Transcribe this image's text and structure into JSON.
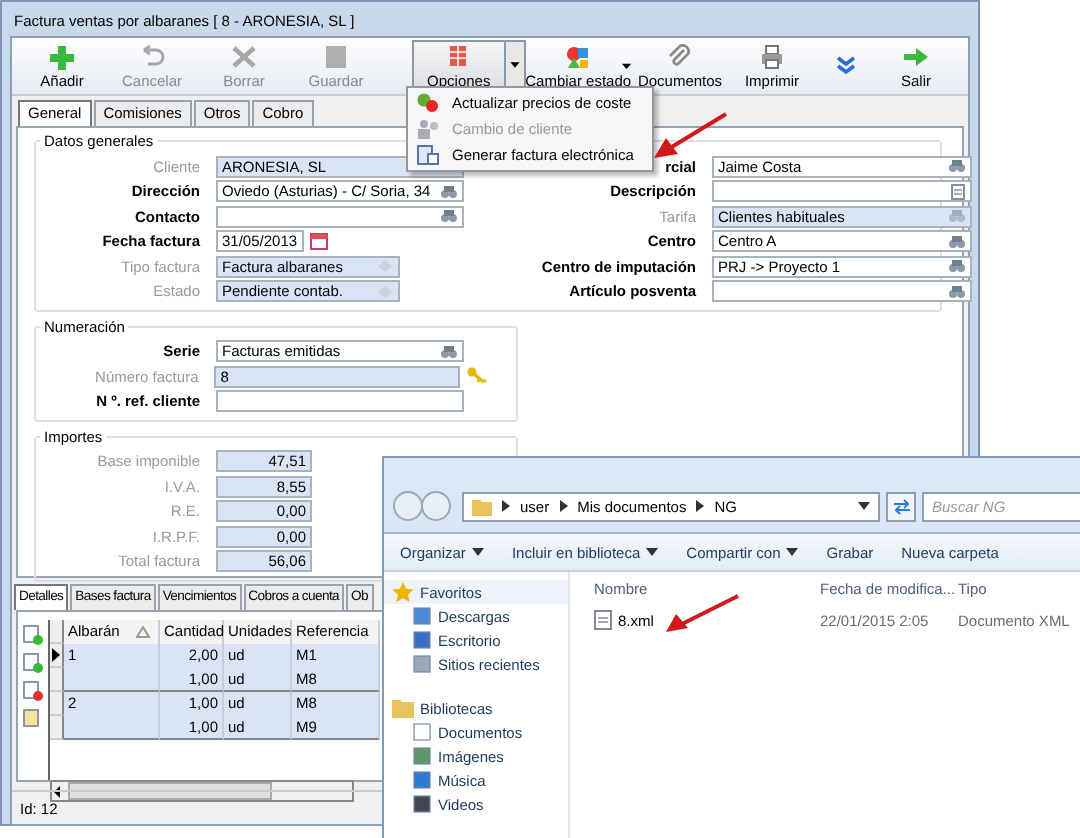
{
  "window": {
    "title": "Factura ventas por albaranes  [ 8  -  ARONESIA, SL ]"
  },
  "toolbar": [
    {
      "label": "Añadir",
      "disabled": false,
      "selected": false
    },
    {
      "label": "Cancelar",
      "disabled": true,
      "selected": false
    },
    {
      "label": "Borrar",
      "disabled": true,
      "selected": false
    },
    {
      "label": "Guardar",
      "disabled": true,
      "selected": false
    },
    {
      "label": "Opciones",
      "disabled": false,
      "selected": true
    },
    {
      "label": "Cambiar estado",
      "disabled": false,
      "selected": false
    },
    {
      "label": "Documentos",
      "disabled": false,
      "selected": false
    },
    {
      "label": "Imprimir",
      "disabled": false,
      "selected": false
    },
    {
      "label": "Salir",
      "disabled": false,
      "selected": false
    }
  ],
  "options_menu": [
    {
      "label": "Actualizar precios de coste",
      "disabled": false
    },
    {
      "label": "Cambio de cliente",
      "disabled": true
    },
    {
      "label": "Generar factura electrónica",
      "disabled": false
    }
  ],
  "tabs": [
    {
      "label": "General",
      "selected": true
    },
    {
      "label": "Comisiones",
      "selected": false
    },
    {
      "label": "Otros",
      "selected": false
    },
    {
      "label": "Cobro",
      "selected": false
    }
  ],
  "groups": [
    {
      "title": "Datos generales",
      "columns": [
        [
          {
            "label": "Cliente",
            "value": "ARONESIA, SL",
            "readonly": true,
            "kind": "text"
          },
          {
            "label": "Dirección",
            "value": "Oviedo (Asturias)  -  C/ Soria, 34",
            "readonly": false,
            "kind": "lookup"
          },
          {
            "label": "Contacto",
            "readonly": false,
            "kind": "lookup"
          },
          {
            "label": "Fecha factura",
            "value": "31/05/2013",
            "readonly": false,
            "kind": "date"
          },
          {
            "label": "Tipo factura",
            "value": "Factura albaranes",
            "readonly": true,
            "kind": "combo"
          },
          {
            "label": "Estado",
            "value": "Pendiente contab.",
            "readonly": true,
            "kind": "combo"
          }
        ],
        [
          {
            "label": "rcial",
            "value": "Jaime Costa",
            "readonly": false,
            "kind": "lookup"
          },
          {
            "label": "Descripción",
            "readonly": false,
            "kind": "memo"
          },
          {
            "label": "Tarifa",
            "value": "Clientes habituales",
            "readonly": true,
            "kind": "lookup"
          },
          {
            "label": "Centro",
            "value": "Centro A",
            "readonly": false,
            "kind": "lookup"
          },
          {
            "label": "Centro de imputación",
            "value": "PRJ -> Proyecto 1",
            "readonly": false,
            "kind": "lookup"
          },
          {
            "label": "Artículo posventa",
            "readonly": false,
            "kind": "lookup"
          }
        ]
      ]
    },
    {
      "title": "Numeración",
      "columns": [
        [
          {
            "label": "Serie",
            "value": "Facturas emitidas",
            "readonly": false,
            "kind": "lookup"
          },
          {
            "label": "Número factura",
            "value": "8",
            "readonly": true,
            "kind": "counter"
          },
          {
            "label": "N º. ref. cliente",
            "readonly": false,
            "kind": "text"
          }
        ]
      ]
    },
    {
      "title": "Importes",
      "columns": [
        [
          {
            "label": "Base imponible",
            "value": "47,51",
            "readonly": true,
            "kind": "amount"
          },
          {
            "label": "I.V.A.",
            "value": "8,55",
            "readonly": true,
            "kind": "amount"
          },
          {
            "label": "R.E.",
            "value": "0,00",
            "readonly": true,
            "kind": "amount"
          },
          {
            "label": "I.R.P.F.",
            "value": "0,00",
            "readonly": true,
            "kind": "amount"
          },
          {
            "label": "Total factura",
            "value": "56,06",
            "readonly": true,
            "kind": "amount"
          }
        ]
      ]
    }
  ],
  "detail_tabs": [
    {
      "label": "Detalles",
      "selected": true
    },
    {
      "label": "Bases factura",
      "selected": false
    },
    {
      "label": "Vencimientos",
      "selected": false
    },
    {
      "label": "Cobros a cuenta",
      "selected": false
    },
    {
      "label": "Ob",
      "selected": false
    }
  ],
  "detail_table": {
    "columns": [
      "Albarán",
      "Cantidad",
      "Unidades",
      "Referencia"
    ],
    "rows": [
      {
        "cells": [
          "1",
          "2,00",
          "ud",
          "M1"
        ],
        "current": true
      },
      {
        "cells": [
          "",
          "1,00",
          "ud",
          "M8"
        ],
        "current": false
      },
      {
        "cells": [
          "2",
          "1,00",
          "ud",
          "M8"
        ],
        "current": false
      },
      {
        "cells": [
          "",
          "1,00",
          "ud",
          "M9"
        ],
        "current": false
      }
    ]
  },
  "status_bar": {
    "id": "Id: 12"
  },
  "explorer": {
    "path": [
      "user",
      "Mis documentos",
      "NG"
    ],
    "search": {
      "placeholder": "Buscar NG"
    },
    "toolbar": [
      {
        "label": "Organizar",
        "dropdown": true
      },
      {
        "label": "Incluir en biblioteca",
        "dropdown": true
      },
      {
        "label": "Compartir con",
        "dropdown": true
      },
      {
        "label": "Grabar",
        "dropdown": false
      },
      {
        "label": "Nueva carpeta",
        "dropdown": false
      }
    ],
    "nav": [
      {
        "label": "Favoritos",
        "selected": true,
        "children": [
          {
            "label": "Descargas",
            "selected": false
          },
          {
            "label": "Escritorio",
            "selected": false
          },
          {
            "label": "Sitios recientes",
            "selected": false
          }
        ]
      },
      {
        "label": "Bibliotecas",
        "selected": false,
        "children": [
          {
            "label": "Documentos",
            "selected": false
          },
          {
            "label": "Imágenes",
            "selected": false
          },
          {
            "label": "Música",
            "selected": false
          },
          {
            "label": "Videos",
            "selected": false
          }
        ]
      }
    ],
    "columns": [
      "Nombre",
      "Fecha de modifica...",
      "Tipo"
    ],
    "files": [
      {
        "name": "8.xml",
        "modified": "22/01/2015 2:05",
        "type": "Documento XML"
      }
    ]
  }
}
